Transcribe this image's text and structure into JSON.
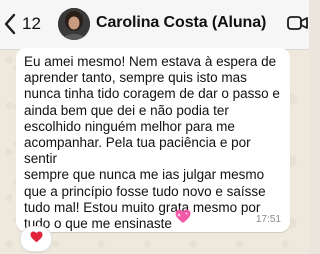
{
  "header": {
    "back_count": "12",
    "contact_name": "Carolina Costa (Aluna)"
  },
  "message": {
    "text": "Eu amei mesmo! Nem estava à espera de\naprender tanto, sempre quis isto mas\nnunca tinha tido coragem de dar o passo e\nainda bem que dei e não podia ter\nescolhido ninguém melhor para me\nacompanhar. Pela tua paciência e por sentir\nsempre que nunca me ias julgar mesmo\nque a princípio fosse tudo novo e saísse\ntudo mal! Estou muito grata mesmo por\ntudo o que me ensinaste",
    "emoji": "sparkling-heart-icon",
    "time": "17:51"
  },
  "reaction": {
    "emoji": "red-heart-icon"
  },
  "colors": {
    "header_bg": "#f6f6f6",
    "chat_bg": "#efe8dc",
    "bubble_bg": "#ffffff",
    "time_color": "#8a8a8a",
    "heart_red": "#e0243a",
    "sparkle_heart_pink": "#f25aa8"
  }
}
